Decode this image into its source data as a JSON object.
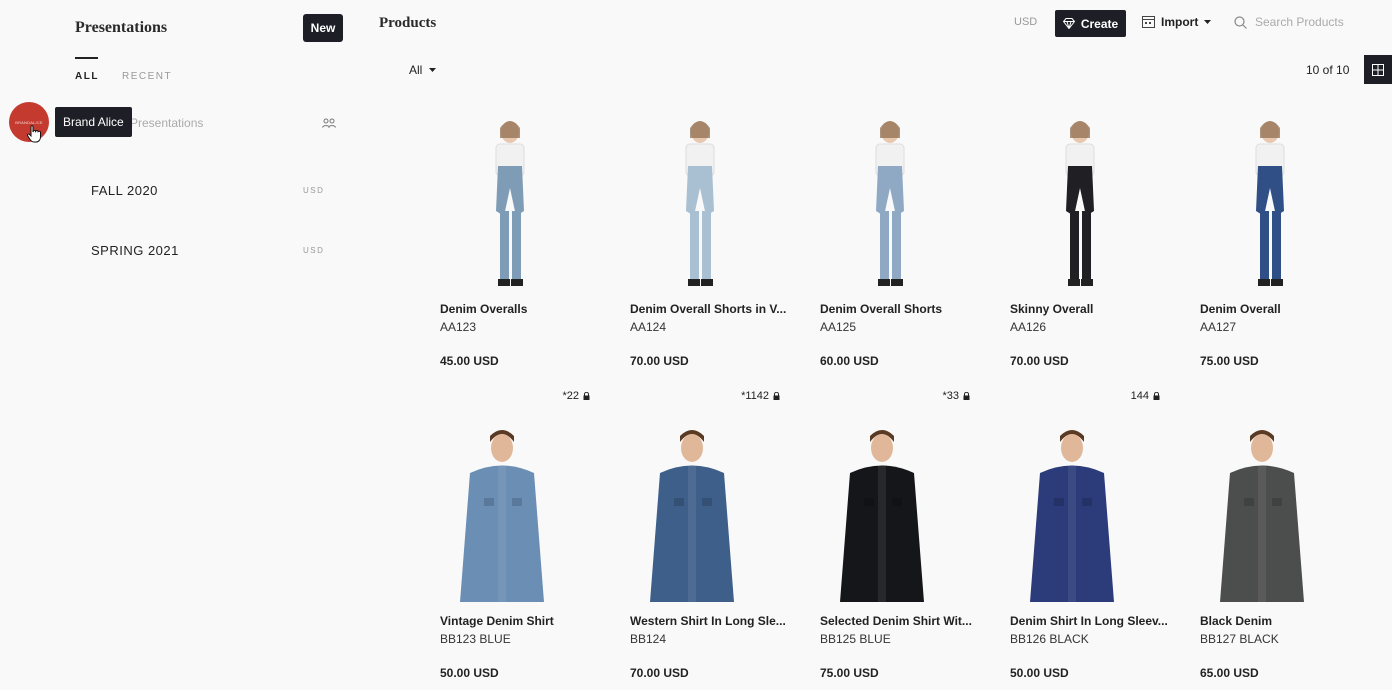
{
  "sidebar": {
    "title": "Presentations",
    "new_label": "New",
    "tabs": [
      {
        "label": "ALL"
      },
      {
        "label": "RECENT"
      }
    ],
    "shared_label": "n Presentations",
    "avatar_text": "BRANDALICE",
    "tooltip": "Brand Alice",
    "presentations": [
      {
        "name": "FALL 2020",
        "currency": "USD"
      },
      {
        "name": "SPRING 2021",
        "currency": "USD"
      }
    ]
  },
  "header": {
    "title": "Products",
    "currency": "USD",
    "create_label": "Create",
    "import_label": "Import",
    "search_placeholder": "Search Products"
  },
  "toolbar": {
    "filter_label": "All",
    "count": "10 of 10"
  },
  "products": [
    {
      "name": "Denim Overalls",
      "sku": "AA123",
      "price": "45.00 USD",
      "stock": "*22",
      "color": "#7f9cb6"
    },
    {
      "name": "Denim Overall Shorts in V...",
      "sku": "AA124",
      "price": "70.00 USD",
      "stock": "*1142",
      "color": "#a9c0d3"
    },
    {
      "name": "Denim Overall Shorts",
      "sku": "AA125",
      "price": "60.00 USD",
      "stock": "*33",
      "color": "#8fa9c4"
    },
    {
      "name": "Skinny Overall",
      "sku": "AA126",
      "price": "70.00 USD",
      "stock": "144",
      "color": "#1f1f24"
    },
    {
      "name": "Denim Overall",
      "sku": "AA127",
      "price": "75.00 USD",
      "stock": "",
      "color": "#2f4f86"
    },
    {
      "name": "Vintage Denim Shirt",
      "sku": "BB123 BLUE",
      "price": "50.00 USD",
      "stock": "",
      "color": "#6a8eb4"
    },
    {
      "name": "Western Shirt In Long Sle...",
      "sku": "BB124",
      "price": "70.00 USD",
      "stock": "",
      "color": "#3e5f8a"
    },
    {
      "name": "Selected Denim Shirt Wit...",
      "sku": "BB125 BLUE",
      "price": "75.00 USD",
      "stock": "",
      "color": "#15161a"
    },
    {
      "name": "Denim Shirt In Long Sleev...",
      "sku": "BB126 BLACK",
      "price": "50.00 USD",
      "stock": "",
      "color": "#2c3b7a"
    },
    {
      "name": "Black Denim",
      "sku": "BB127 BLACK",
      "price": "65.00 USD",
      "stock": "",
      "color": "#4c4d4d"
    }
  ]
}
